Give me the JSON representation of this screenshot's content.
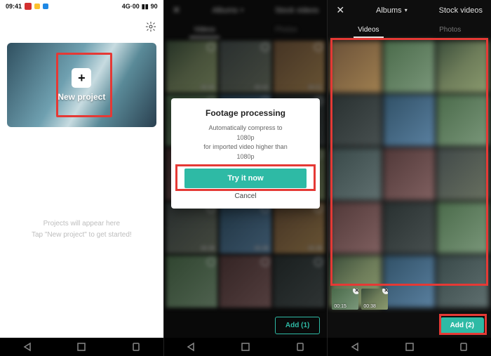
{
  "status": {
    "time": "09:41",
    "net_label": "4G·00",
    "battery": "90"
  },
  "screen1": {
    "new_project_label": "New project",
    "empty_line1": "Projects will appear here",
    "empty_line2": "Tap \"New project\" to get started!"
  },
  "gallery": {
    "close_glyph": "✕",
    "albums_label": "Albums",
    "stock_label": "Stock videos",
    "tab_videos": "Videos",
    "tab_photos": "Photos"
  },
  "dialog": {
    "title": "Footage processing",
    "body_line1": "Automatically compress to",
    "body_line2": "1080p",
    "body_line3": "for imported video higher than",
    "body_line4": "1080p",
    "try": "Try it now",
    "cancel": "Cancel"
  },
  "screen2": {
    "durations": [
      "00:40",
      "00:42",
      "00:51",
      "",
      "",
      "",
      "",
      "",
      "",
      "00:38",
      "00:38",
      "00:38",
      "",
      "",
      ""
    ],
    "add_label": "Add (1)"
  },
  "screen3": {
    "add_label": "Add (2)",
    "selected": [
      {
        "dur": "00:15"
      },
      {
        "dur": "00:38"
      }
    ]
  }
}
